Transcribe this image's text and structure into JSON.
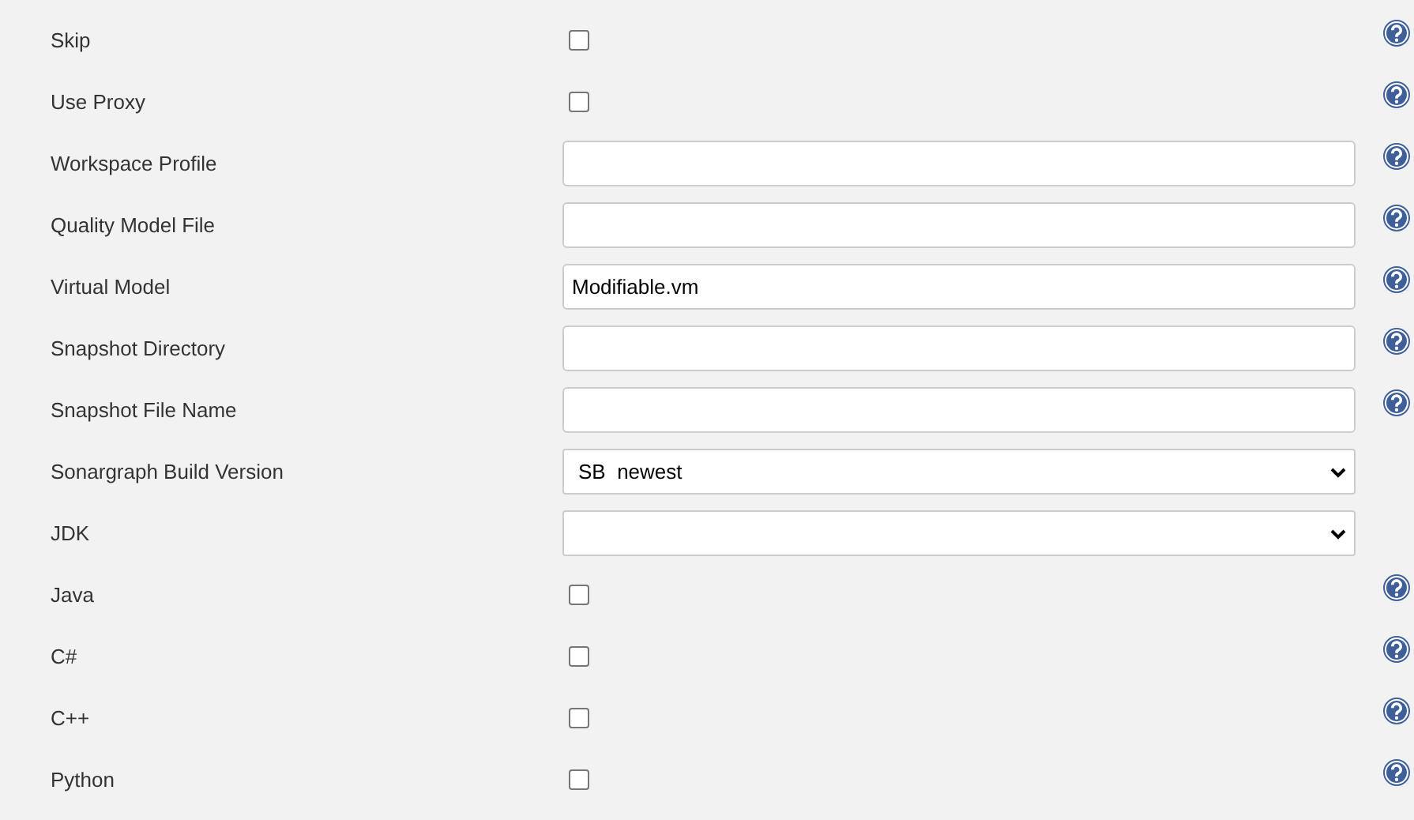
{
  "rows": [
    {
      "label": "Skip",
      "kind": "checkbox",
      "checked": false,
      "help": true
    },
    {
      "label": "Use Proxy",
      "kind": "checkbox",
      "checked": false,
      "help": true
    },
    {
      "label": "Workspace Profile",
      "kind": "text",
      "help": true
    },
    {
      "label": "Quality Model File",
      "kind": "text",
      "help": true
    },
    {
      "label": "Virtual Model",
      "kind": "text",
      "value": "Modifiable.vm",
      "help": true
    },
    {
      "label": "Snapshot Directory",
      "kind": "text",
      "help": true
    },
    {
      "label": "Snapshot File Name",
      "kind": "text",
      "help": true
    },
    {
      "label": "Sonargraph Build Version",
      "kind": "select",
      "value": "SB  newest",
      "help": false
    },
    {
      "label": "JDK",
      "kind": "select",
      "help": false
    },
    {
      "label": "Java",
      "kind": "checkbox",
      "checked": false,
      "help": true
    },
    {
      "label": "C#",
      "kind": "checkbox",
      "checked": false,
      "help": true
    },
    {
      "label": "C++",
      "kind": "checkbox",
      "checked": false,
      "help": true
    },
    {
      "label": "Python",
      "kind": "checkbox",
      "checked": false,
      "help": true
    }
  ]
}
